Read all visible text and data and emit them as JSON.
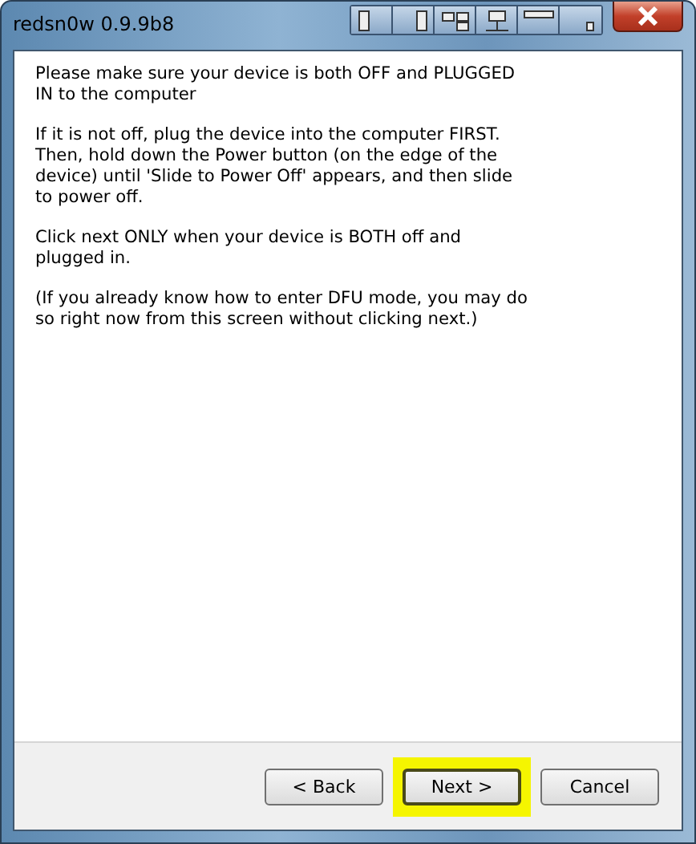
{
  "window": {
    "title": "redsn0w 0.9.9b8"
  },
  "paragraphs": [
    "Please make sure your device is both OFF and PLUGGED IN to the computer",
    "If it is not off, plug the device into the computer FIRST. Then, hold down the Power button (on the edge of the device) until 'Slide to Power Off' appears, and then slide to power off.",
    "Click next ONLY when your device is BOTH off and plugged in.",
    "(If you already know how to enter DFU mode, you may do so right now from this screen without clicking next.)"
  ],
  "buttons": [
    {
      "label": "< Back",
      "highlighted": false
    },
    {
      "label": "Next >",
      "highlighted": true
    },
    {
      "label": "Cancel",
      "highlighted": false
    }
  ]
}
